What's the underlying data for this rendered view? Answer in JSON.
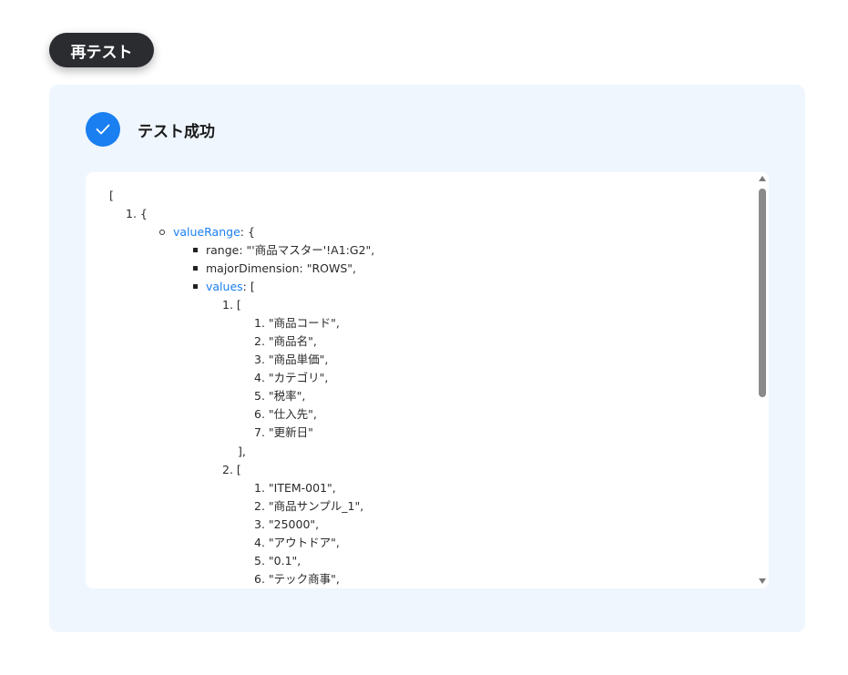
{
  "retest_button": {
    "label": "再テスト"
  },
  "result": {
    "status_title": "テスト成功",
    "status_icon": "check-icon",
    "accent_color": "#1a7ff0"
  },
  "output": {
    "open_bracket": "[",
    "item1_marker": "1. {",
    "value_range_key": "valueRange",
    "value_range_suffix": ": {",
    "range_line": "range: \"'商品マスター'!A1:G2\",",
    "major_dimension_line": "majorDimension: \"ROWS\",",
    "values_key": "values",
    "values_suffix": ": [",
    "row1_marker": "1. [",
    "row1_items": [
      "1. \"商品コード\",",
      "2. \"商品名\",",
      "3. \"商品単価\",",
      "4. \"カテゴリ\",",
      "5. \"税率\",",
      "6. \"仕入先\",",
      "7. \"更新日\""
    ],
    "row1_close": "],",
    "row2_marker": "2. [",
    "row2_items": [
      "1. \"ITEM-001\",",
      "2. \"商品サンプル_1\",",
      "3. \"25000\",",
      "4. \"アウトドア\",",
      "5. \"0.1\",",
      "6. \"テック商事\","
    ]
  }
}
